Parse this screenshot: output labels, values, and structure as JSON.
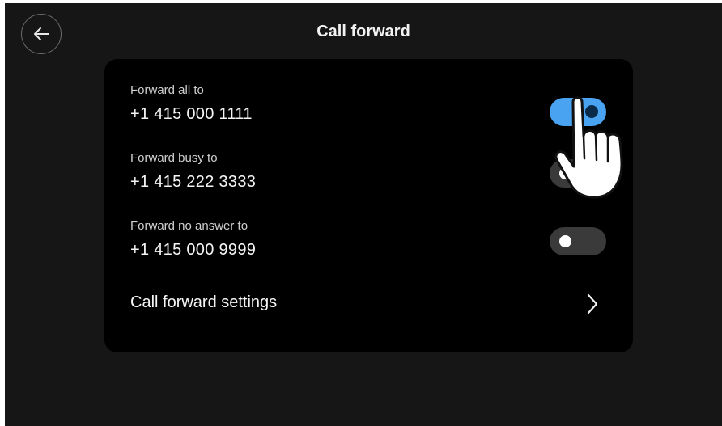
{
  "header": {
    "title": "Call forward",
    "back_icon": "arrow-left-icon"
  },
  "rows": [
    {
      "label": "Forward all to",
      "number": "+1 415 000 1111",
      "enabled": true
    },
    {
      "label": "Forward busy to",
      "number": "+1 415 222 3333",
      "enabled": false
    },
    {
      "label": "Forward no answer to",
      "number": "+1 415 000 9999",
      "enabled": false
    }
  ],
  "settings": {
    "label": "Call forward settings",
    "icon": "chevron-right-icon"
  },
  "overlay": {
    "icon": "pointing-hand-icon"
  },
  "colors": {
    "background": "#161616",
    "card": "#000000",
    "toggle_on": "#4aa3f0",
    "toggle_off": "#3a3a3a"
  }
}
